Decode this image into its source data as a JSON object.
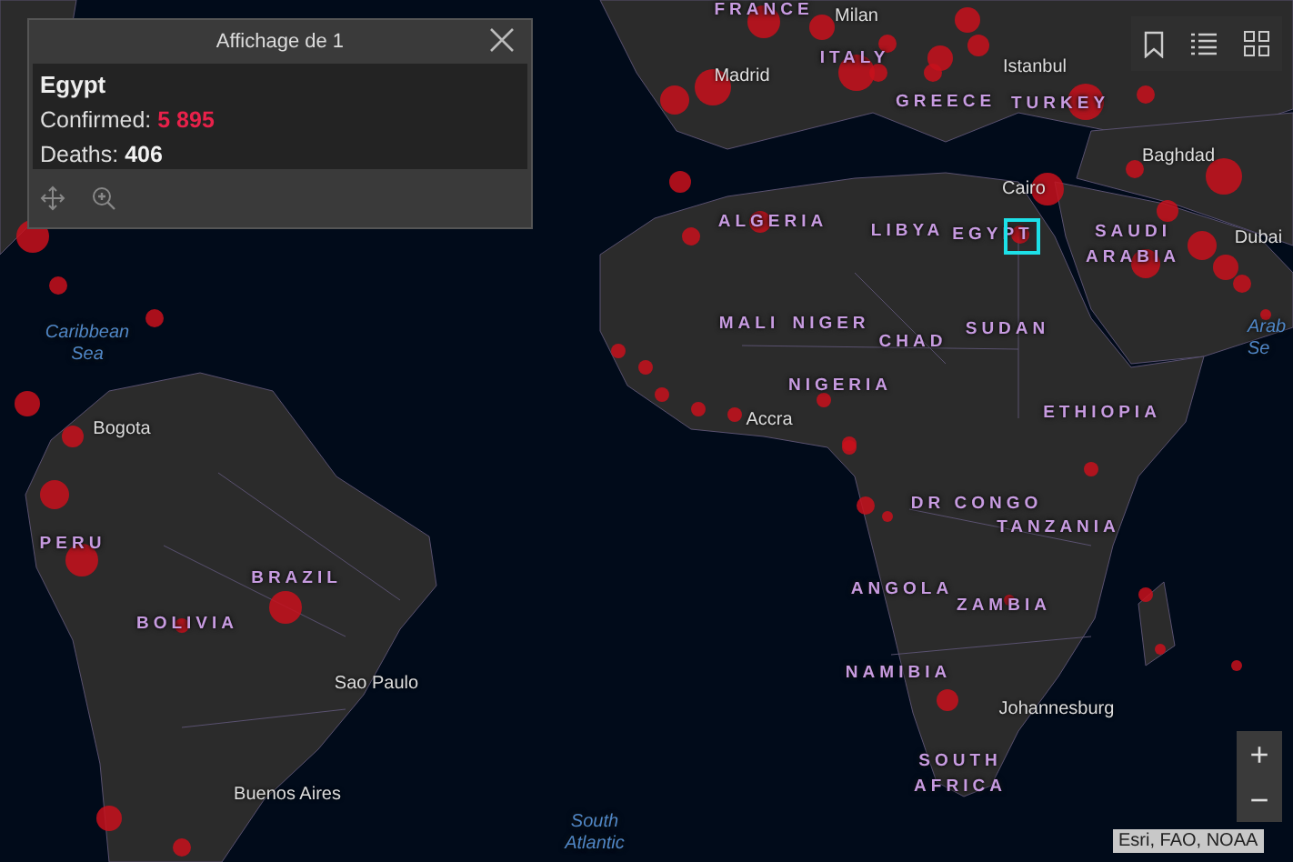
{
  "popup": {
    "title": "Affichage de 1",
    "name": "Egypt",
    "fields": [
      {
        "label": "Confirmed:",
        "value": "5 895",
        "kind": "alert"
      },
      {
        "label": "Deaths:",
        "value": "406",
        "kind": "plain"
      }
    ]
  },
  "map": {
    "labels": [
      {
        "text": "FRANCE",
        "kind": "country"
      },
      {
        "text": "Milan",
        "kind": "city"
      },
      {
        "text": "ITALY",
        "kind": "country"
      },
      {
        "text": "Istanbul",
        "kind": "city"
      },
      {
        "text": "Madrid",
        "kind": "city"
      },
      {
        "text": "GREECE",
        "kind": "country"
      },
      {
        "text": "TURKEY",
        "kind": "country"
      },
      {
        "text": "Baghdad",
        "kind": "city"
      },
      {
        "text": "Cairo",
        "kind": "city"
      },
      {
        "text": "ALGERIA",
        "kind": "country"
      },
      {
        "text": "LIBYA",
        "kind": "country"
      },
      {
        "text": "EGYPT",
        "kind": "country"
      },
      {
        "text": "SAUDI ARABIA",
        "kind": "country"
      },
      {
        "text": "Dubai",
        "kind": "city"
      },
      {
        "text": "Caribbean Sea",
        "kind": "water"
      },
      {
        "text": "MALI",
        "kind": "country"
      },
      {
        "text": "NIGER",
        "kind": "country"
      },
      {
        "text": "CHAD",
        "kind": "country"
      },
      {
        "text": "SUDAN",
        "kind": "country"
      },
      {
        "text": "Arab Se",
        "kind": "water"
      },
      {
        "text": "NIGERIA",
        "kind": "country"
      },
      {
        "text": "Bogota",
        "kind": "city"
      },
      {
        "text": "Accra",
        "kind": "city"
      },
      {
        "text": "ETHIOPIA",
        "kind": "country"
      },
      {
        "text": "DR CONGO",
        "kind": "country"
      },
      {
        "text": "PERU",
        "kind": "country"
      },
      {
        "text": "TANZANIA",
        "kind": "country"
      },
      {
        "text": "BRAZIL",
        "kind": "country"
      },
      {
        "text": "ANGOLA",
        "kind": "country"
      },
      {
        "text": "ZAMBIA",
        "kind": "country"
      },
      {
        "text": "BOLIVIA",
        "kind": "country"
      },
      {
        "text": "NAMIBIA",
        "kind": "country"
      },
      {
        "text": "Sao Paulo",
        "kind": "city"
      },
      {
        "text": "Johannesburg",
        "kind": "city"
      },
      {
        "text": "SOUTH AFRICA",
        "kind": "country"
      },
      {
        "text": "Buenos Aires",
        "kind": "city"
      },
      {
        "text": "South Atlantic",
        "kind": "water"
      }
    ]
  },
  "zoom_controls": [
    {
      "label": "+"
    },
    {
      "label": "−"
    }
  ],
  "attribution": "Esri, FAO, NOAA"
}
